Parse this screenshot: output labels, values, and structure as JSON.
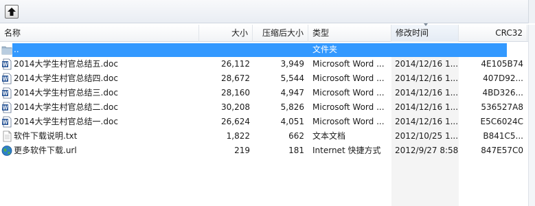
{
  "toolbar": {
    "up_button_icon": "folder-up-icon"
  },
  "columns": {
    "name": "名称",
    "size": "大小",
    "packed": "压缩后大小",
    "type": "类型",
    "modified": "修改时间",
    "crc": "CRC32"
  },
  "rows": [
    {
      "icon": "folder-up-icon",
      "name": "..",
      "size": "",
      "packed": "",
      "type": "文件夹",
      "modified": "",
      "crc": ""
    },
    {
      "icon": "word-doc-icon",
      "name": "2014大学生村官总结五.doc",
      "size": "26,112",
      "packed": "3,949",
      "type": "Microsoft Word ...",
      "modified": "2014/12/16 1...",
      "crc": "4E105B74"
    },
    {
      "icon": "word-doc-icon",
      "name": "2014大学生村官总结四.doc",
      "size": "28,672",
      "packed": "5,544",
      "type": "Microsoft Word ...",
      "modified": "2014/12/16 1...",
      "crc": "407D92..."
    },
    {
      "icon": "word-doc-icon",
      "name": "2014大学生村官总结三.doc",
      "size": "28,160",
      "packed": "4,947",
      "type": "Microsoft Word ...",
      "modified": "2014/12/16 1...",
      "crc": "4BD326..."
    },
    {
      "icon": "word-doc-icon",
      "name": "2014大学生村官总结二.doc",
      "size": "30,208",
      "packed": "5,826",
      "type": "Microsoft Word ...",
      "modified": "2014/12/16 1...",
      "crc": "536527A8"
    },
    {
      "icon": "word-doc-icon",
      "name": "2014大学生村官总结一.doc",
      "size": "26,624",
      "packed": "4,051",
      "type": "Microsoft Word ...",
      "modified": "2014/12/16 1...",
      "crc": "E5C6024C"
    },
    {
      "icon": "text-file-icon",
      "name": "软件下载说明.txt",
      "size": "1,822",
      "packed": "662",
      "type": "文本文档",
      "modified": "2012/10/25 1...",
      "crc": "B841C5..."
    },
    {
      "icon": "internet-shortcut-icon",
      "name": "更多软件下载.url",
      "size": "219",
      "packed": "181",
      "type": "Internet 快捷方式",
      "modified": "2012/9/27 8:58",
      "crc": "847E57C0"
    }
  ],
  "colors": {
    "selection": "#3399ff",
    "sorted_column": "#f4f4f4"
  }
}
